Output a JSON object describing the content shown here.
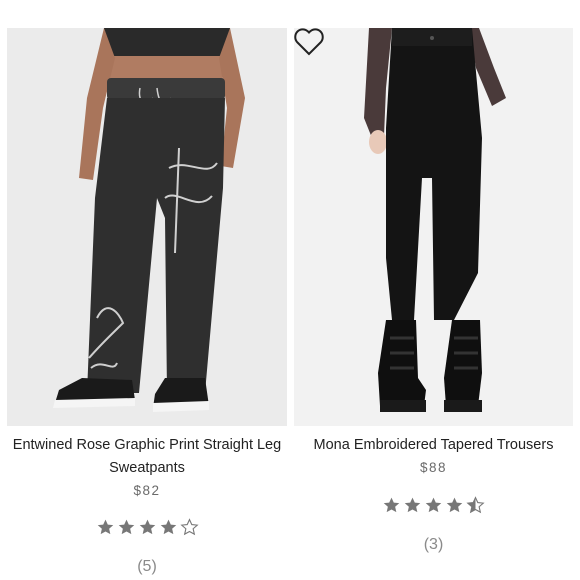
{
  "products": [
    {
      "title": "Entwined Rose Graphic Print Straight Leg Sweatpants",
      "price": "$82",
      "rating": 4,
      "rating_max": 5,
      "review_count": "(5)",
      "image_icon": "gray-graphic-sweatpants-photo"
    },
    {
      "title": "Mona Embroidered Tapered Trousers",
      "price": "$88",
      "rating": 4.5,
      "rating_max": 5,
      "review_count": "(3)",
      "image_icon": "black-tapered-trousers-photo",
      "wishlist_icon": "heart-outline-icon"
    }
  ],
  "colors": {
    "star_fill": "#777777",
    "text": "#222222",
    "price": "#6a6a6a",
    "review": "#8a8a8a"
  }
}
